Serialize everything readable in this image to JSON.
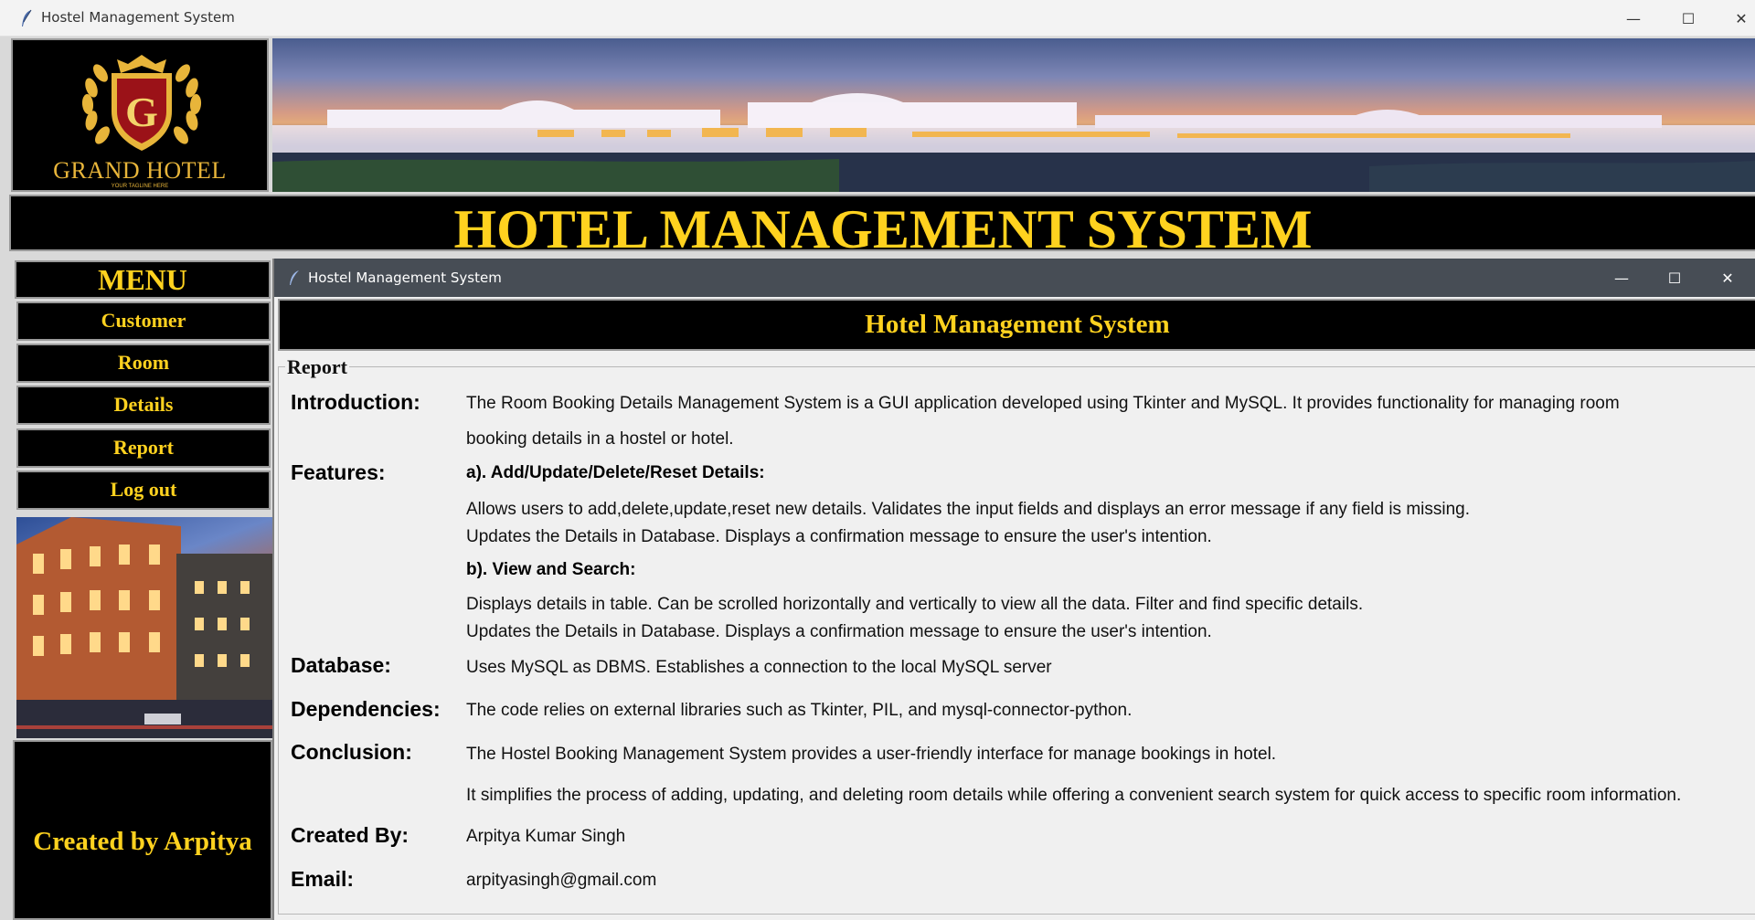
{
  "window": {
    "title": "Hostel Management System",
    "minimize_glyph": "—",
    "maximize_glyph": "☐",
    "close_glyph": "✕"
  },
  "logo": {
    "brand": "GRAND HOTEL",
    "letter": "G",
    "tagline": "YOUR TAGLINE HERE",
    "gold": "#e8b53a"
  },
  "heading": "HOTEL MANAGEMENT SYSTEM",
  "menu": {
    "title": "MENU",
    "items": [
      "Customer",
      "Room",
      "Details",
      "Report",
      "Log out"
    ]
  },
  "footer": {
    "created": "Created by Arpitya"
  },
  "inner_window": {
    "title": "Hostel Management System",
    "header": "Hotel Management System"
  },
  "report": {
    "legend": "Report",
    "introduction": {
      "label": "Introduction:",
      "line1": "The Room Booking Details Management System is a GUI application developed using Tkinter and MySQL. It provides functionality for managing room",
      "line2": "booking details in a hostel or hotel."
    },
    "features": {
      "label": "Features:",
      "a_title": "a). Add/Update/Delete/Reset Details:",
      "a_line1": "Allows users to add,delete,update,reset new details. Validates the input fields and displays an error message if any field is missing.",
      "a_line2": "Updates the Details in Database. Displays a confirmation message to ensure the user's intention.",
      "b_title": "b). View and Search:",
      "b_line1": "Displays details in table. Can be scrolled horizontally and vertically to view all the data. Filter and find specific details.",
      "b_line2": "Updates the Details in Database. Displays a confirmation message to ensure the user's intention."
    },
    "database": {
      "label": "Database:",
      "text": "Uses MySQL as DBMS. Establishes a connection to the local MySQL server"
    },
    "dependencies": {
      "label": "Dependencies:",
      "text": "The code relies on external libraries such as Tkinter, PIL, and mysql-connector-python."
    },
    "conclusion": {
      "label": "Conclusion:",
      "line1": "The Hostel Booking Management System provides a user-friendly interface for manage bookings in hotel.",
      "line2": "It simplifies the process of adding, updating, and deleting room details while offering a convenient search system for quick access to specific room information."
    },
    "created_by": {
      "label": "Created By:",
      "value": "Arpitya Kumar Singh"
    },
    "email": {
      "label": "Email:",
      "value": "arpityasingh@gmail.com"
    }
  },
  "colors": {
    "accent_yellow": "#ffd21f",
    "panel_black": "#000000",
    "inner_titlebar": "#474d55"
  }
}
